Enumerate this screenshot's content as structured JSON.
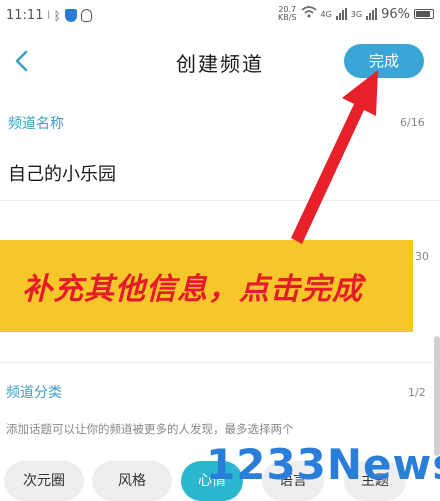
{
  "status": {
    "time": "11:11",
    "speed_value": "20.7",
    "speed_unit": "KB/S",
    "sim1": "4G",
    "sim2": "3G",
    "battery": "96%"
  },
  "header": {
    "title": "创建频道",
    "done_label": "完成"
  },
  "name_section": {
    "label": "频道名称",
    "counter": "6/16",
    "value": "自己的小乐园"
  },
  "desc_section": {
    "counter_partial": "30"
  },
  "banner": {
    "text": "补充其他信息，点击完成"
  },
  "category_section": {
    "label": "频道分类",
    "counter": "1/2",
    "hint": "添加话题可以让你的频道被更多的人发现，最多选择两个",
    "tags": [
      {
        "label": "次元圈",
        "selected": false
      },
      {
        "label": "风格",
        "selected": false
      },
      {
        "label": "心情",
        "selected": true
      },
      {
        "label": "语言",
        "selected": false
      },
      {
        "label": "主题",
        "selected": false
      }
    ]
  },
  "watermark": "1233News",
  "colors": {
    "accent": "#3aa6d6",
    "tag_selected": "#2ab6cf",
    "banner_bg": "#f7c62a",
    "banner_text": "#e41b2a",
    "arrow": "#e8202a"
  }
}
